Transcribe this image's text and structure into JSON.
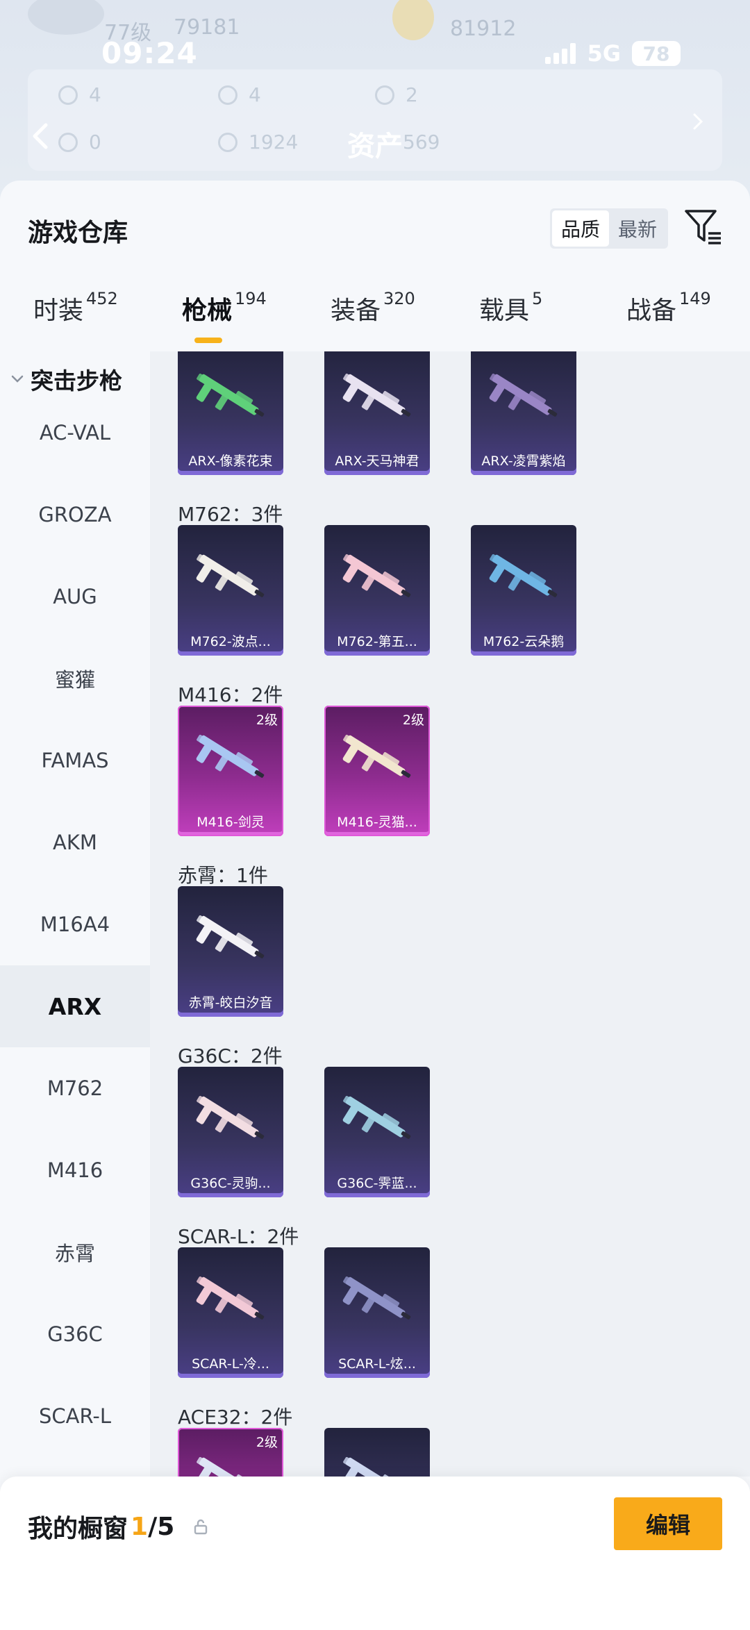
{
  "background": {
    "profile_level": "77级",
    "profile_fans": "79181",
    "profile2_value": "81912",
    "stats": [
      "4",
      "4",
      "2",
      "0",
      "1924",
      "569"
    ],
    "title": "资产"
  },
  "status_bar": {
    "time": "09:24",
    "network": "5G",
    "battery": "78"
  },
  "sheet": {
    "title": "游戏仓库",
    "sort_options": [
      {
        "label": "品质",
        "active": true
      },
      {
        "label": "最新",
        "active": false
      }
    ]
  },
  "tabs": [
    {
      "label": "时装",
      "count": "452",
      "active": false
    },
    {
      "label": "枪械",
      "count": "194",
      "active": true
    },
    {
      "label": "装备",
      "count": "320",
      "active": false
    },
    {
      "label": "载具",
      "count": "5",
      "active": false
    },
    {
      "label": "战备",
      "count": "149",
      "active": false
    }
  ],
  "sidebar": {
    "header": "突击步枪",
    "items": [
      {
        "label": "AC-VAL",
        "active": false
      },
      {
        "label": "GROZA",
        "active": false
      },
      {
        "label": "AUG",
        "active": false
      },
      {
        "label": "蜜獾",
        "active": false
      },
      {
        "label": "FAMAS",
        "active": false
      },
      {
        "label": "AKM",
        "active": false
      },
      {
        "label": "M16A4",
        "active": false
      },
      {
        "label": "ARX",
        "active": true
      },
      {
        "label": "M762",
        "active": false
      },
      {
        "label": "M416",
        "active": false
      },
      {
        "label": "赤霄",
        "active": false
      },
      {
        "label": "G36C",
        "active": false
      },
      {
        "label": "SCAR-L",
        "active": false
      }
    ]
  },
  "groups": [
    {
      "label": "",
      "items": [
        {
          "name": "ARX-像素花束",
          "level": "",
          "tier": "purple",
          "tint": "#5fd07a"
        },
        {
          "name": "ARX-天马神君",
          "level": "",
          "tier": "purple",
          "tint": "#e8e2f0"
        },
        {
          "name": "ARX-凌霄紫焰",
          "level": "",
          "tier": "purple",
          "tint": "#9a86c6"
        }
      ]
    },
    {
      "label": "M762：3件",
      "items": [
        {
          "name": "M762-波点...",
          "level": "",
          "tier": "purple",
          "tint": "#f1eee9"
        },
        {
          "name": "M762-第五...",
          "level": "",
          "tier": "purple",
          "tint": "#f4c7d4"
        },
        {
          "name": "M762-云朵鹅",
          "level": "",
          "tier": "purple",
          "tint": "#6fb6e4"
        }
      ]
    },
    {
      "label": "M416：2件",
      "items": [
        {
          "name": "M416-剑灵",
          "level": "2级",
          "tier": "pink",
          "tint": "#a9c7f2"
        },
        {
          "name": "M416-灵猫...",
          "level": "2级",
          "tier": "pink",
          "tint": "#f2e6cf"
        }
      ]
    },
    {
      "label": "赤霄：1件",
      "items": [
        {
          "name": "赤霄-皎白汐音",
          "level": "",
          "tier": "purple",
          "tint": "#f3f2f6"
        }
      ]
    },
    {
      "label": "G36C：2件",
      "items": [
        {
          "name": "G36C-灵驹...",
          "level": "",
          "tier": "purple",
          "tint": "#f2dde2"
        },
        {
          "name": "G36C-霁蓝...",
          "level": "",
          "tier": "purple",
          "tint": "#9fd0e2"
        }
      ]
    },
    {
      "label": "SCAR-L：2件",
      "items": [
        {
          "name": "SCAR-L-冷...",
          "level": "",
          "tier": "purple",
          "tint": "#f2c9d6"
        },
        {
          "name": "SCAR-L-炫...",
          "level": "",
          "tier": "purple",
          "tint": "#8f93c8"
        }
      ]
    },
    {
      "label": "ACE32：2件",
      "items": [
        {
          "name": "",
          "level": "2级",
          "tier": "pink",
          "tint": "#dfe6f6"
        },
        {
          "name": "",
          "level": "",
          "tier": "purple",
          "tint": "#cfd9f2"
        }
      ]
    }
  ],
  "bottom_bar": {
    "showcase_label": "我的橱窗",
    "showcase_current": "1",
    "showcase_total": "/5",
    "edit_label": "编辑"
  },
  "colors": {
    "accent": "#f9b21d",
    "sheet_bg": "#f6f8fb",
    "content_bg": "#eef1f5",
    "card_purple": "#38345f",
    "card_pink": "#8e2c8f"
  },
  "icons": {
    "back": "chevron-left-icon",
    "filter": "filter-list-icon",
    "share": "share-external-icon",
    "lock": "lock-icon",
    "section_toggle": "chevron-down-icon"
  }
}
